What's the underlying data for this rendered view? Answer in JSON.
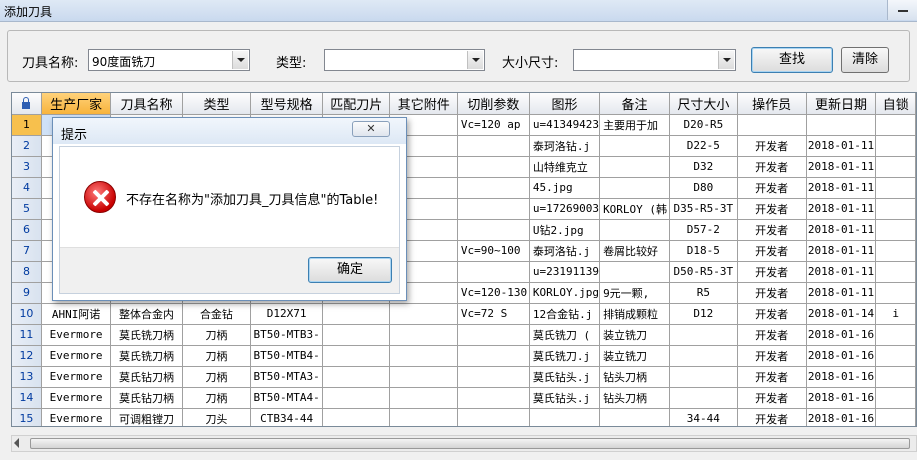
{
  "window": {
    "title": "添加刀具"
  },
  "search": {
    "name_label": "刀具名称:",
    "name_value": "90度面铣刀",
    "type_label": "类型:",
    "type_value": "",
    "size_label": "大小尺寸:",
    "size_value": "",
    "find_label": "查找",
    "clear_label": "清除"
  },
  "table": {
    "headers": [
      "生产厂家",
      "刀具名称",
      "类型",
      "型号规格",
      "匹配刀片",
      "其它附件",
      "切削参数",
      "图形",
      "备注",
      "尺寸大小",
      "操作员",
      "更新日期",
      "自锁"
    ],
    "rows": [
      {
        "n": "1",
        "cells": [
          "",
          "",
          "",
          "",
          "",
          "",
          "Vc=120   ap",
          "u=41349423",
          "主要用于加",
          "D20-R5",
          "",
          "",
          ""
        ]
      },
      {
        "n": "2",
        "cells": [
          "",
          "",
          "",
          "",
          "",
          "",
          "",
          "泰珂洛钻.j",
          "",
          "D22-5",
          "开发者",
          "2018-01-11",
          ""
        ]
      },
      {
        "n": "3",
        "cells": [
          "",
          "",
          "",
          "",
          "",
          "",
          "",
          "山特维克立",
          "",
          "D32",
          "开发者",
          "2018-01-11",
          ""
        ]
      },
      {
        "n": "4",
        "cells": [
          "",
          "",
          "",
          "",
          "",
          "",
          "",
          "45.jpg",
          "",
          "D80",
          "开发者",
          "2018-01-11",
          ""
        ]
      },
      {
        "n": "5",
        "cells": [
          "",
          "",
          "",
          "",
          "",
          "",
          "",
          "u=17269003",
          "KORLOY (韩",
          "D35-R5-3T",
          "开发者",
          "2018-01-11",
          ""
        ]
      },
      {
        "n": "6",
        "cells": [
          "",
          "",
          "",
          "",
          "",
          "",
          "",
          "U钻2.jpg",
          "",
          "D57-2",
          "开发者",
          "2018-01-11",
          ""
        ]
      },
      {
        "n": "7",
        "cells": [
          "",
          "",
          "",
          "",
          "",
          "",
          "Vc=90~100",
          "泰珂洛钻.j",
          "卷屑比较好",
          "D18-5",
          "开发者",
          "2018-01-11",
          ""
        ]
      },
      {
        "n": "8",
        "cells": [
          "",
          "",
          "",
          "",
          "",
          "",
          "",
          "u=23191139",
          "",
          "D50-R5-3T",
          "开发者",
          "2018-01-11",
          ""
        ]
      },
      {
        "n": "9",
        "cells": [
          "",
          "",
          "",
          "",
          "",
          "",
          "Vc=120-130",
          "KORLOY.jpg",
          "9元一颗,",
          "R5",
          "开发者",
          "2018-01-11",
          ""
        ]
      },
      {
        "n": "10",
        "cells": [
          "AHNI阿诺",
          "整体合金内",
          "合金钻",
          "D12X71",
          "",
          "",
          "Vc=72     S",
          "12合金钻.j",
          "排销成颗粒",
          "D12",
          "开发者",
          "2018-01-14",
          "i"
        ]
      },
      {
        "n": "11",
        "cells": [
          "Evermore",
          "莫氏铣刀柄",
          "刀柄",
          "BT50-MTB3-",
          "",
          "",
          "",
          "莫氏铣刀 (",
          "装立铣刀",
          "",
          "开发者",
          "2018-01-16",
          ""
        ]
      },
      {
        "n": "12",
        "cells": [
          "Evermore",
          "莫氏铣刀柄",
          "刀柄",
          "BT50-MTB4-",
          "",
          "",
          "",
          "莫氏铣刀.j",
          "装立铣刀",
          "",
          "开发者",
          "2018-01-16",
          ""
        ]
      },
      {
        "n": "13",
        "cells": [
          "Evermore",
          "莫氏钻刀柄",
          "刀柄",
          "BT50-MTA3-",
          "",
          "",
          "",
          "莫氏钻头.j",
          "钻头刀柄",
          "",
          "开发者",
          "2018-01-16",
          ""
        ]
      },
      {
        "n": "14",
        "cells": [
          "Evermore",
          "莫氏钻刀柄",
          "刀柄",
          "BT50-MTA4-",
          "",
          "",
          "",
          "莫氏钻头.j",
          "钻头刀柄",
          "",
          "开发者",
          "2018-01-16",
          ""
        ]
      },
      {
        "n": "15",
        "cells": [
          "Evermore",
          "可调粗镗刀",
          "刀头",
          "CTB34-44",
          "",
          "",
          "",
          "",
          "",
          "34-44",
          "开发者",
          "2018-01-16",
          ""
        ]
      }
    ]
  },
  "dialog": {
    "title": "提示",
    "message": "不存在名称为\"添加刀具_刀具信息\"的Table!",
    "ok_label": "确定",
    "close_glyph": "✕"
  },
  "icons": {
    "corner": "lock-icon",
    "dialog": "error-icon"
  }
}
